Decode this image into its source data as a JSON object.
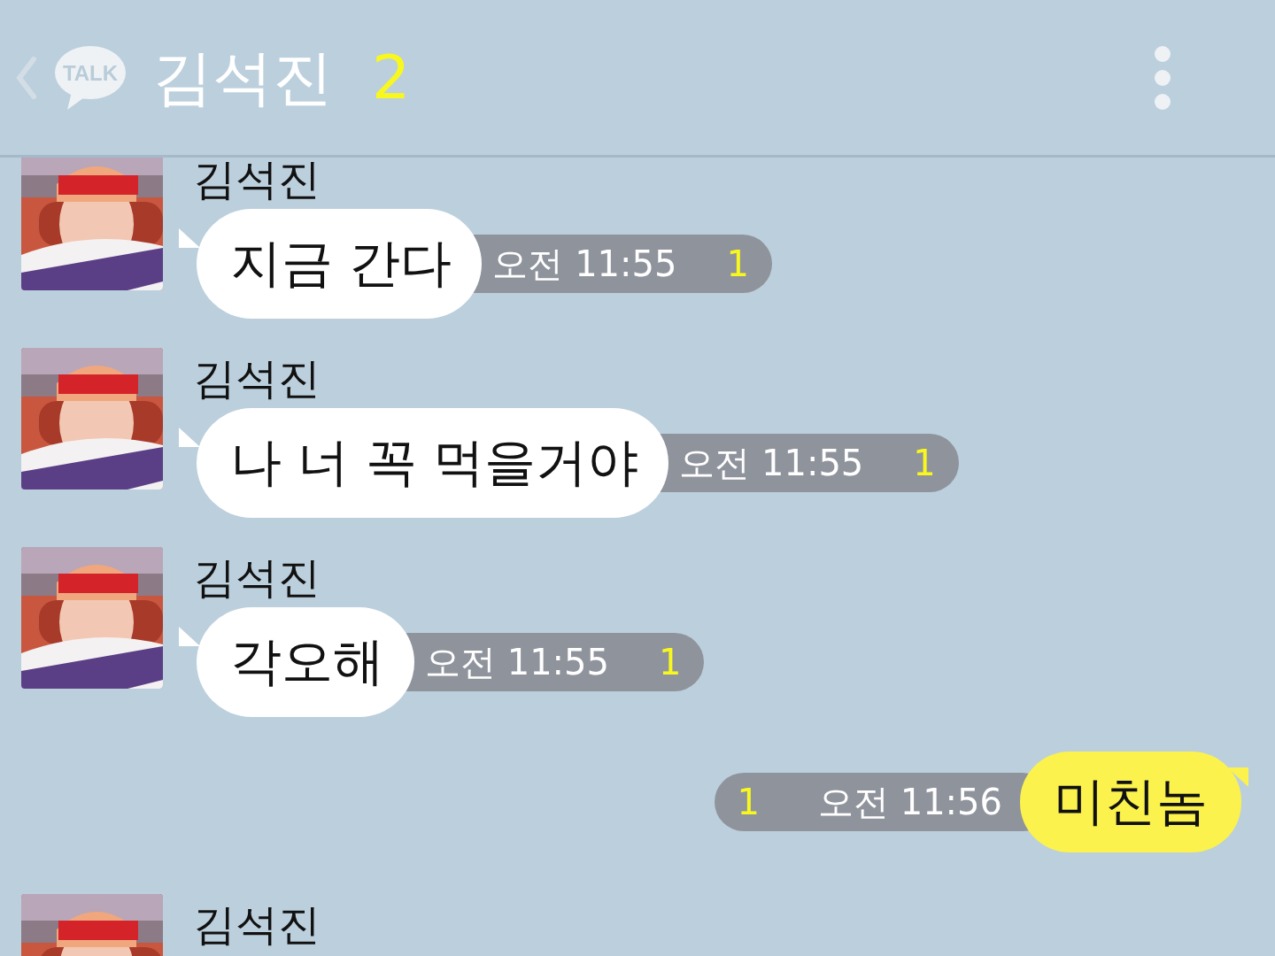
{
  "header": {
    "logo_text": "TALK",
    "title": "김석진",
    "member_count": "2"
  },
  "messages": [
    {
      "kind": "received",
      "sender": "김석진",
      "text": "지금 간다",
      "time": "오전 11:55",
      "unread": "1"
    },
    {
      "kind": "received",
      "sender": "김석진",
      "text": "나 너 꼭 먹을거야",
      "time": "오전 11:55",
      "unread": "1"
    },
    {
      "kind": "received",
      "sender": "김석진",
      "text": "각오해",
      "time": "오전 11:55",
      "unread": "1"
    },
    {
      "kind": "sent",
      "text": "미친놈",
      "time": "오전 11:56",
      "unread": "1"
    },
    {
      "kind": "received",
      "sender": "김석진"
    }
  ]
}
